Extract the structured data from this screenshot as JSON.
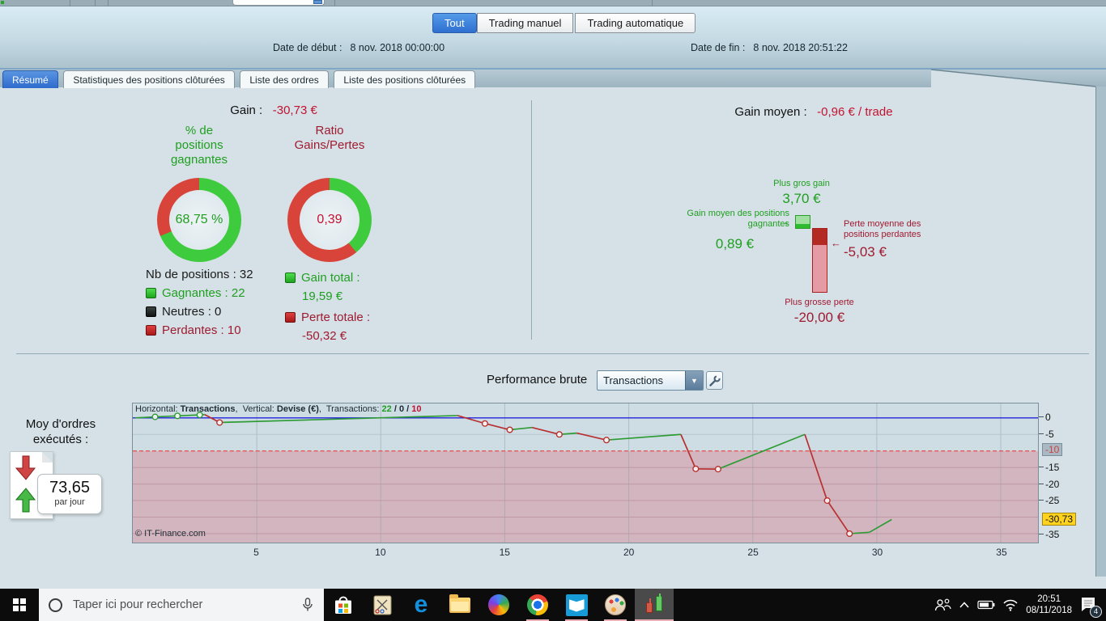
{
  "misc": {
    "comma": ", ",
    "slash": " / "
  },
  "colors": {
    "accent_blue": "#3d7fd6",
    "green": "#1f9f1f",
    "dark_red": "#a01a30",
    "value_red": "#c41230",
    "donut_green": "#3ecb3e",
    "donut_red": "#d8443a",
    "chart_blue_bg": "#cedde4",
    "chart_pink_bg": "#d3b5bf",
    "zero_line_blue": "#2222dd",
    "threshold_red": "#e05858",
    "current_value_yellow": "#ffd21e"
  },
  "header": {
    "filters": [
      {
        "label": "Tout",
        "active": true
      },
      {
        "label": "Trading manuel",
        "active": false
      },
      {
        "label": "Trading automatique",
        "active": false
      }
    ],
    "date_start_label": "Date de début :",
    "date_start_value": "8 nov. 2018 00:00:00",
    "date_end_label": "Date de fin :",
    "date_end_value": "8 nov. 2018 20:51:22"
  },
  "tabs": [
    {
      "label": "Résumé",
      "active": true
    },
    {
      "label": "Statistiques des positions clôturées",
      "active": false
    },
    {
      "label": "Liste des ordres",
      "active": false
    },
    {
      "label": "Liste des positions clôturées",
      "active": false
    }
  ],
  "summary": {
    "gain_label": "Gain :",
    "gain_value": "-30,73 €",
    "left_donut": {
      "title": "% de\npositions\ngagnantes",
      "value": "68,75 %",
      "green_pct": 68.75
    },
    "right_donut": {
      "title": "Ratio\nGains/Pertes",
      "value": "0,39",
      "green_pct": 39
    },
    "positions_total": "Nb de positions : 32",
    "positions_rows": [
      {
        "text": "Gagnantes : 22",
        "color": "green"
      },
      {
        "text": "Neutres : 0",
        "color": "black"
      },
      {
        "text": "Perdantes : 10",
        "color": "red"
      }
    ],
    "gain_total_label": "Gain total :",
    "gain_total_value": "19,59 €",
    "perte_totale_label": "Perte totale :",
    "perte_totale_value": "-50,32 €"
  },
  "gain_moyen": {
    "label": "Gain moyen :",
    "value": "-0,96 € / trade",
    "biggest_gain_label": "Plus gros gain",
    "biggest_gain_value": "3,70 €",
    "avg_gain_label": "Gain moyen des positions\ngagnantes",
    "avg_gain_value": "0,89 €",
    "avg_loss_label": "Perte moyenne des\npositions perdantes",
    "avg_loss_value": "-5,03 €",
    "biggest_loss_label": "Plus grosse perte",
    "biggest_loss_value": "-20,00 €"
  },
  "performance": {
    "title": "Performance brute",
    "dropdown_value": "Transactions",
    "moy_label": "Moy d'ordres\nexécutés :",
    "moy_value": "73,65",
    "moy_unit": "par jour",
    "copyright": "© IT-Finance.com",
    "chart_header": {
      "h_label": "Horizontal:",
      "h_value": "Transactions",
      "v_label": "Vertical:",
      "v_value": "Devise (€)",
      "t_label": "Transactions:",
      "wins": "22",
      "neutral": "0",
      "losses": "10"
    }
  },
  "chart_data": {
    "type": "line",
    "title": "Performance brute",
    "xlabel": "Transactions",
    "ylabel": "Devise (€)",
    "x": [
      0.1,
      0.9,
      1.8,
      2.7,
      2.9,
      3.5,
      13.1,
      14.2,
      15.2,
      16.1,
      17.2,
      17.9,
      19.1,
      22.1,
      22.7,
      23.6,
      27.1,
      28,
      28.9,
      29.7,
      30.6
    ],
    "y": [
      0,
      0.3,
      0.6,
      0.9,
      1.0,
      -1.4,
      0.7,
      -1.7,
      -3.6,
      -2.9,
      -5.0,
      -4.6,
      -6.7,
      -5.0,
      -15.4,
      -15.5,
      -5.0,
      -25.0,
      -35.0,
      -34.6,
      -30.73
    ],
    "marker_x": [
      0.9,
      1.8,
      2.7,
      3.5,
      14.2,
      15.2,
      17.2,
      19.1,
      22.7,
      23.6,
      28,
      28.9
    ],
    "x_ticks": [
      5,
      10,
      15,
      20,
      25,
      30,
      35
    ],
    "y_ticks": [
      0,
      -5,
      -15,
      -20,
      -25,
      -35
    ],
    "y_grid": [
      -5,
      -15,
      -20,
      -25,
      -30,
      -35
    ],
    "threshold": -10,
    "threshold_label": "-10",
    "current": -30.73,
    "current_label": "-30,73",
    "zero_line": 0,
    "xlim": [
      0,
      36.5
    ],
    "ylim": [
      -37.7,
      4.35
    ],
    "wins": 22,
    "neutral": 0,
    "losses": 10,
    "final_value": -30.73
  },
  "taskbar": {
    "search_placeholder": "Taper ici pour rechercher",
    "clock_time": "20:51",
    "clock_date": "08/11/2018",
    "notification_badge": "4",
    "icons": [
      "start",
      "cortana-search",
      "microphone",
      "store",
      "snipping-tool",
      "edge",
      "file-explorer",
      "globe-app",
      "chrome",
      "book-app",
      "paint",
      "trading-app",
      "people",
      "chevron-up",
      "battery",
      "wifi",
      "notifications"
    ]
  }
}
